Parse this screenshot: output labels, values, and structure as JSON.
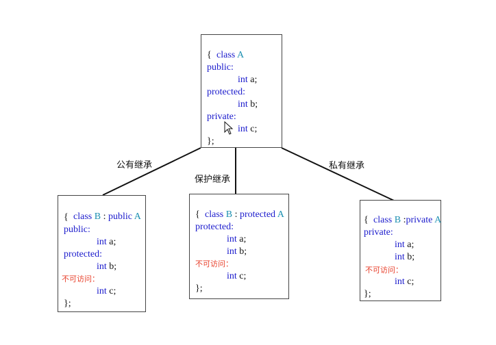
{
  "parent": {
    "kw_class": "class",
    "name": "A",
    "open": "{",
    "public": "public:",
    "int_a": "int a;",
    "protected": "protected:",
    "int_b": "int b;",
    "private": "private:",
    "int_c": "int c;",
    "close": "};"
  },
  "edges": {
    "public": "公有继承",
    "protected": "保护继承",
    "private": "私有继承"
  },
  "child_public": {
    "kw_class": "class",
    "name": "B",
    "sep": " : ",
    "kw_mode": "public",
    "base": "A",
    "open": "{",
    "section1": "public:",
    "int_a": "int a;",
    "section2": "protected:",
    "int_b": "int b;",
    "inaccessible": "不可访问：",
    "int_c": "int c;",
    "close": "};"
  },
  "child_protected": {
    "kw_class": "class",
    "name": "B",
    "sep": " : ",
    "kw_mode": "protected",
    "base": "A",
    "open": "{",
    "section1": "protected:",
    "int_a": "int a;",
    "int_b": "int b;",
    "inaccessible": "不可访问：",
    "int_c": "int c;",
    "close": "};"
  },
  "child_private": {
    "kw_class": "class",
    "name": "B",
    "sep": " :",
    "kw_mode": "private",
    "base": "A",
    "open": "{",
    "section1": "private:",
    "int_a": "int a;",
    "int_b": "int b;",
    "inaccessible": "不可访问：",
    "int_c": "int c;",
    "close": "};"
  },
  "colors": {
    "keyword": "#1a1acc",
    "class_name": "#1b8fb0",
    "inaccessible": "#e8412c",
    "border": "#444444",
    "connector": "#111111"
  }
}
